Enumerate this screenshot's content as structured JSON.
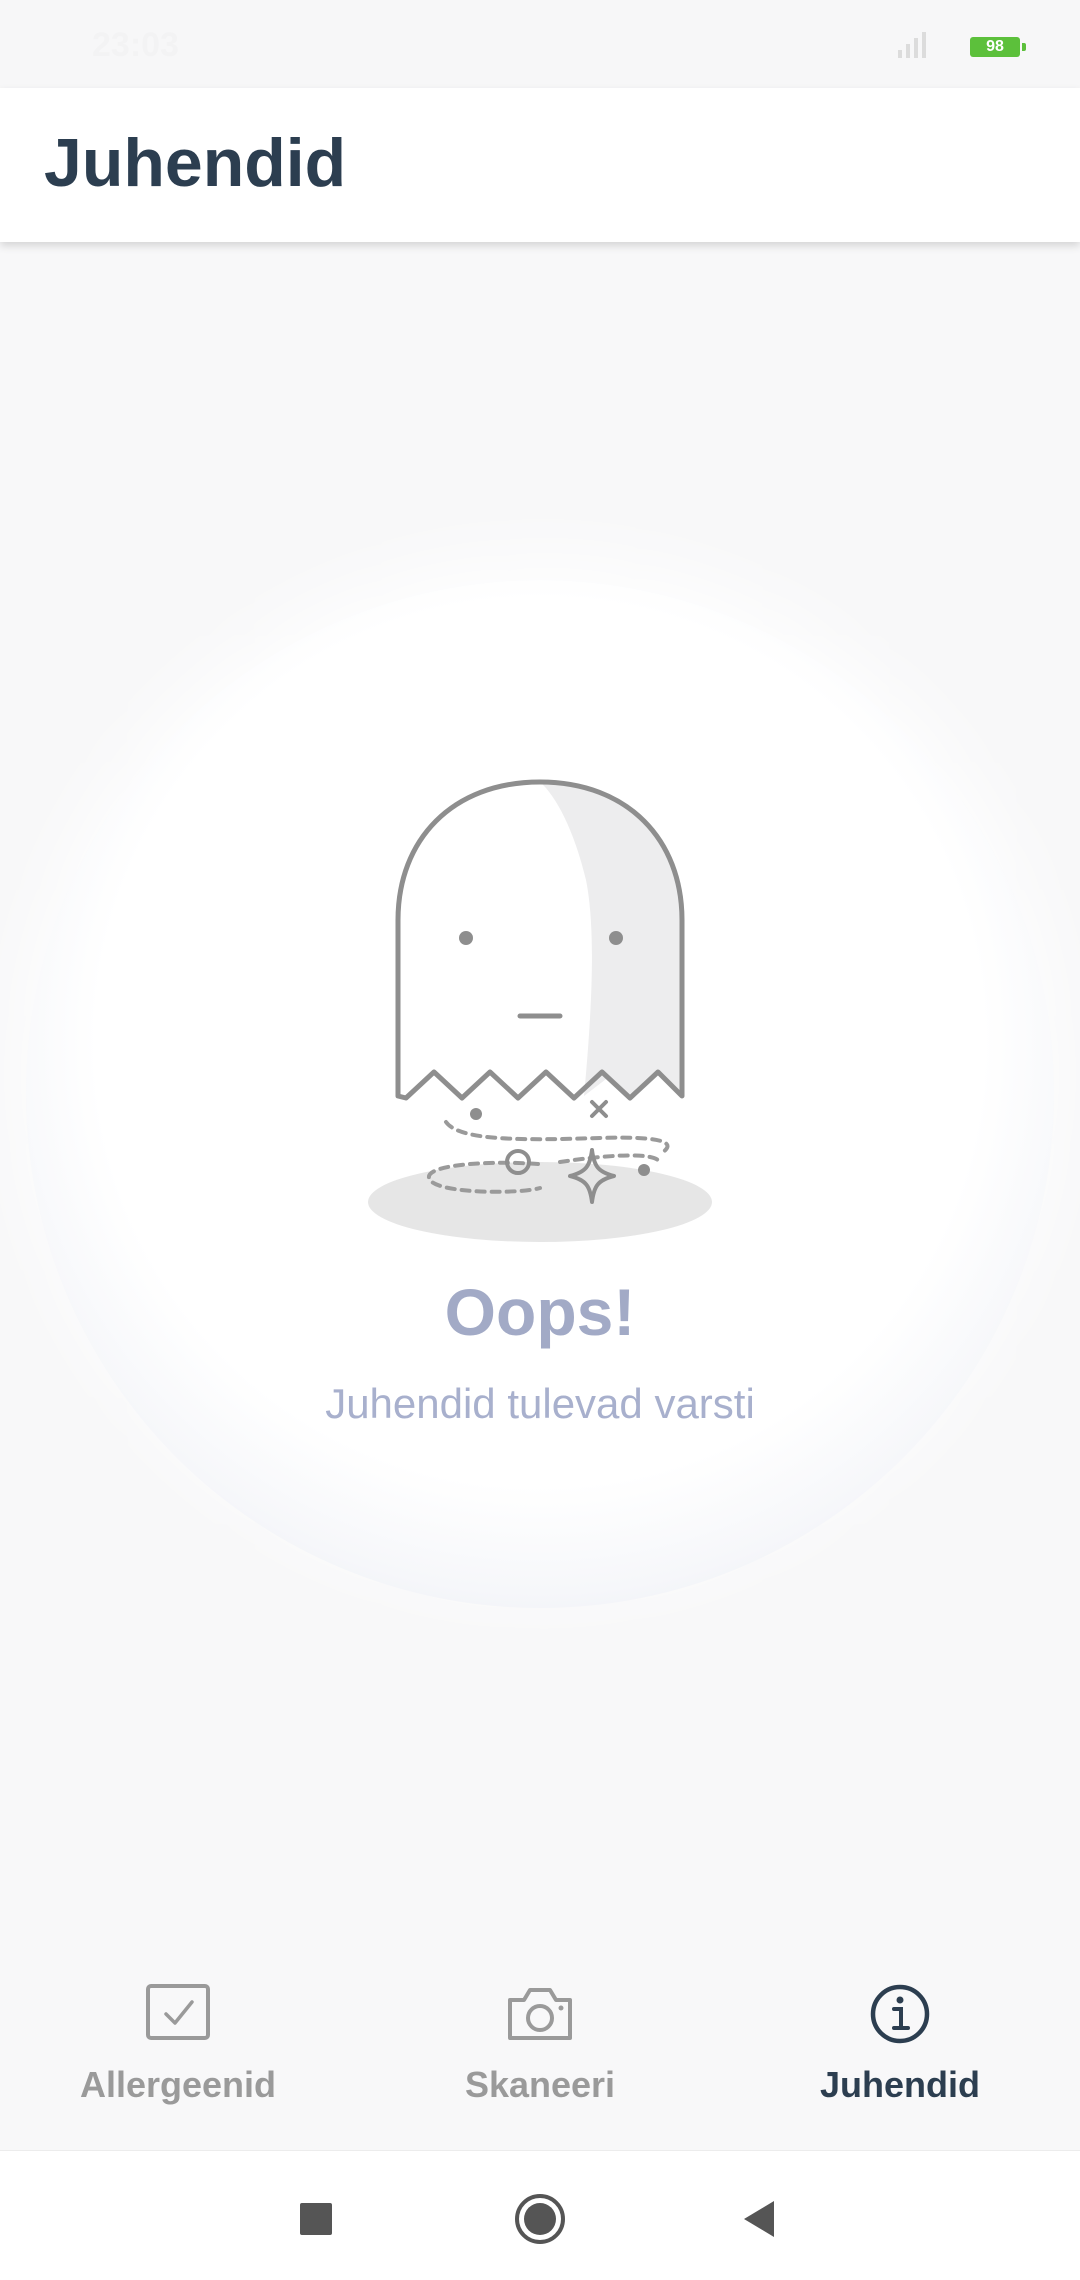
{
  "status_bar": {
    "time": "23:03",
    "battery": "98",
    "battery_color": "#5cc03b"
  },
  "header": {
    "title": "Juhendid"
  },
  "empty_state": {
    "illustration": "ghost-illustration",
    "title": "Oops!",
    "message": "Juhendid tulevad varsti"
  },
  "bottom_nav": {
    "items": [
      {
        "label": "Allergeenid",
        "icon": "checkbox-icon",
        "active": false
      },
      {
        "label": "Skaneeri",
        "icon": "camera-icon",
        "active": false
      },
      {
        "label": "Juhendid",
        "icon": "info-icon",
        "active": true
      }
    ]
  },
  "system_nav": {
    "buttons": [
      "recents-square-icon",
      "home-circle-icon",
      "back-triangle-icon"
    ]
  },
  "colors": {
    "title_text": "#2c3e50",
    "accent_muted": "#a2aac6",
    "inactive_nav": "#9a9a9a"
  }
}
